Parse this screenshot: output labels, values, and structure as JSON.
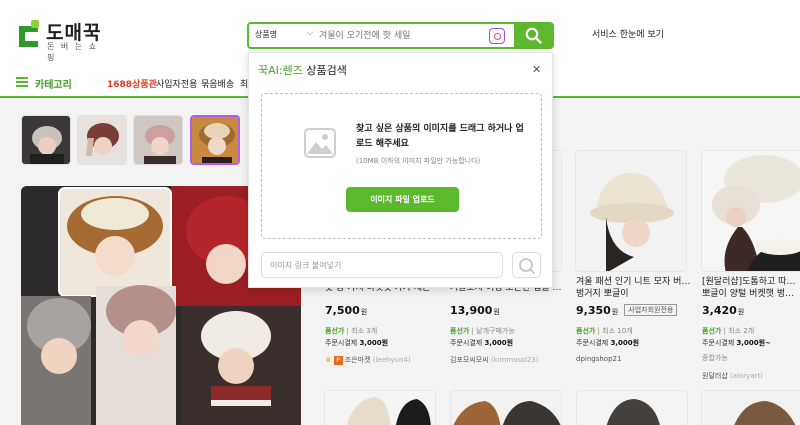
{
  "header": {
    "logo_text": "도매꾹",
    "logo_sub": "돈 버 는 쇼 핑",
    "search_select": "상품명",
    "search_placeholder": "겨울이 오기전에 핫 세일",
    "service_link": "서비스 한눈에 보기",
    "brand_color": "#5cb82c"
  },
  "nav": {
    "category_label": "카테고리",
    "items": [
      "1688상품관",
      "사입자전용",
      "묶음배송",
      "최"
    ]
  },
  "popup": {
    "brand": "꾹AI:렌즈",
    "title": " 상품검색",
    "drop_text": "찾고 싶은 상품의 이미지를 드래그 하거나 업로드 해주세요",
    "drop_sub": "(10MB 이하의 이미지 파일만 가능합니다)",
    "upload_label": "이미지 파일 업로드",
    "link_placeholder": "이미지 링크 붙여넣기"
  },
  "products": [
    {
      "title": "곳 공 가지 바멧멋 가가 제는",
      "price": "7,500",
      "unit": "원",
      "tag": "품선가",
      "min": "최소 3개",
      "ship_label": "주문시결제",
      "ship_fee": "3,000원",
      "seller_prefix": "조은마켓",
      "seller_id": "(leehyun4)"
    },
    {
      "title": "겨울모자 어성 포근한 겹글 모...",
      "price": "13,900",
      "unit": "원",
      "tag": "품선가",
      "min": "낱개구매가능",
      "ship_label": "주문시결제",
      "ship_fee": "3,000원",
      "seller_prefix": "김포모씨모씨",
      "seller_id": "(kimmossi23)"
    },
    {
      "title": "겨울 패션 인기 니트 모자 버켓햇",
      "title2": "벙거지 뽀글이",
      "price": "9,350",
      "unit": "원",
      "badge": "사업자회원전용",
      "tag": "품선가",
      "min": "최소 10개",
      "ship_label": "주문시결제",
      "ship_fee": "3,000원",
      "seller_prefix": "dpingshop21",
      "seller_id": ""
    },
    {
      "title": "[원달러샵]도톰하고 따뜻한 뽀",
      "title2": "뽀글이 양털 버켓햇 벙거지",
      "price": "3,420",
      "unit": "원",
      "tag": "품선가",
      "min": "최소 2개",
      "ship_label": "주문시결제",
      "ship_fee": "3,000원~",
      "extra": "종합가능",
      "seller_prefix": "원달러샵",
      "seller_id": "(aloryart)"
    }
  ]
}
